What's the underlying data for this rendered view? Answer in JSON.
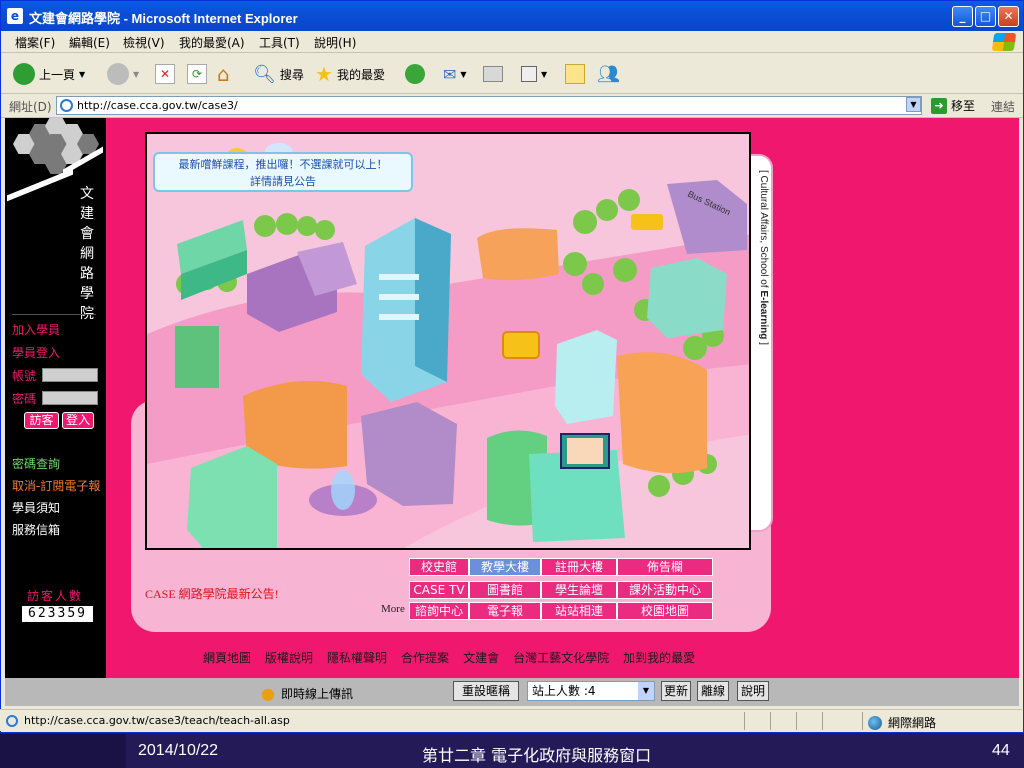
{
  "window": {
    "title": "文建會網路學院 - Microsoft Internet Explorer"
  },
  "menu": [
    "檔案(F)",
    "編輯(E)",
    "檢視(V)",
    "我的最愛(A)",
    "工具(T)",
    "說明(H)"
  ],
  "toolbar": {
    "back": "上一頁",
    "search": "搜尋",
    "favorites": "我的最愛"
  },
  "address": {
    "label": "網址(D)",
    "url": "http://case.cca.gov.tw/case3/",
    "go": "移至",
    "links": "連結"
  },
  "sidebar": {
    "school_name": "文建會網路學院",
    "join": "加入學員",
    "login_title": "學員登入",
    "account_label": "帳號",
    "password_label": "密碼",
    "guest_button": "訪客",
    "login_button": "登入",
    "forgot_password": "密碼查詢",
    "newsletter": "取消-訂閱電子報",
    "student_notice": "學員須知",
    "service_mail": "服務信箱",
    "visitor_label": "訪客人數",
    "visitor_count": "623359"
  },
  "map": {
    "banner_line1": "最新嚐鮮課程，推出囉！不選課就可以上！",
    "banner_line2": "詳情請見公告",
    "bus_station": "Bus Station",
    "tab_text_prefix": "[ Cultural Affairs, School of ",
    "tab_text_bold": "E-learning",
    "tab_text_suffix": " ]"
  },
  "announce": "CASE 網路學院最新公告!",
  "more": "More",
  "nav": [
    [
      "校史館",
      "教學大樓",
      "註冊大樓",
      "佈告欄"
    ],
    [
      "CASE TV",
      "圖書館",
      "學生論壇",
      "課外活動中心"
    ],
    [
      "諮詢中心",
      "電子報",
      "站站相連",
      "校園地圖"
    ]
  ],
  "footer_links": [
    "網頁地圖",
    "版權說明",
    "隱私權聲明",
    "合作提案",
    "文建會",
    "台灣工藝文化學院",
    "加到我的最愛"
  ],
  "bottom": {
    "uploader": "即時線上傳訊",
    "reset": "重設暱稱",
    "online": "站上人數 :4",
    "refresh": "更新",
    "leave": "離線",
    "help": "說明"
  },
  "status": {
    "url": "http://case.cca.gov.tw/case3/teach/teach-all.asp",
    "zone": "網際網路"
  },
  "slide": {
    "date": "2014/10/22",
    "title": "第廿二章 電子化政府與服務窗口",
    "page": "44"
  }
}
